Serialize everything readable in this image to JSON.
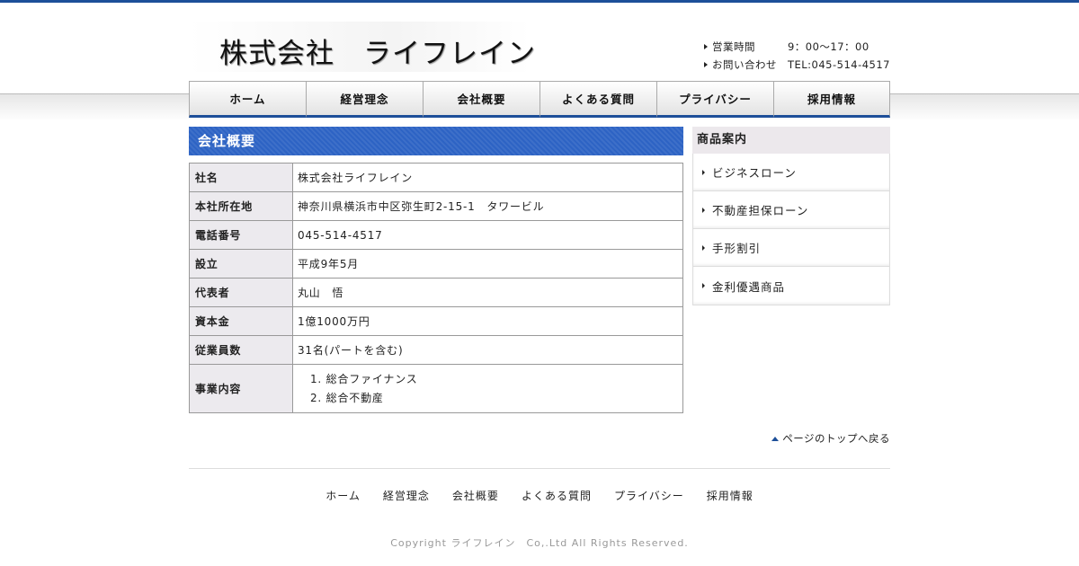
{
  "header": {
    "logo_text": "株式会社　ライフレイン",
    "hours_label": "営業時間",
    "hours_value": "9：00～17：00",
    "contact_label": "お問い合わせ",
    "contact_value": "TEL:045-514-4517"
  },
  "nav": [
    "ホーム",
    "経営理念",
    "会社概要",
    "よくある質問",
    "プライバシー",
    "採用情報"
  ],
  "main": {
    "title": "会社概要",
    "rows": [
      {
        "label": "社名",
        "value": "株式会社ライフレイン"
      },
      {
        "label": "本社所在地",
        "value": "神奈川県横浜市中区弥生町2-15-1　タワービル"
      },
      {
        "label": "電話番号",
        "value": "045-514-4517"
      },
      {
        "label": "設立",
        "value": "平成9年5月"
      },
      {
        "label": "代表者",
        "value": "丸山　悟"
      },
      {
        "label": "資本金",
        "value": "1億1000万円"
      },
      {
        "label": "従業員数",
        "value": "31名(パートを含む)"
      }
    ],
    "business": {
      "label": "事業内容",
      "items": [
        "1. 総合ファイナンス",
        "2. 総合不動産"
      ]
    }
  },
  "sidebar": {
    "title": "商品案内",
    "items": [
      "ビジネスローン",
      "不動産担保ローン",
      "手形割引",
      "金利優遇商品"
    ]
  },
  "pagetop": "ページのトップへ戻る",
  "footer": {
    "nav": [
      "ホーム",
      "経営理念",
      "会社概要",
      "よくある質問",
      "プライバシー",
      "採用情報"
    ],
    "copyright": "Copyright ライフレイン　Co,.Ltd All Rights Reserved."
  },
  "colors": {
    "accent": "#1d4f99",
    "title_bg": "#2d63c4",
    "label_bg": "#eceaee"
  }
}
